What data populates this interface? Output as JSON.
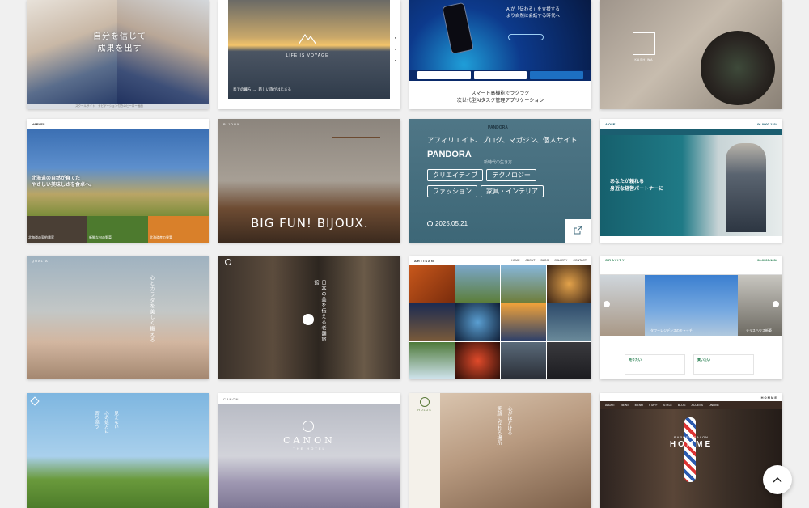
{
  "cards": [
    {
      "id": "c1",
      "headline_line1": "自分を信じて",
      "headline_line2": "成果を出す",
      "caption": "スクールサイト　ナビゲーション付きのヒーロー画面"
    },
    {
      "id": "c2",
      "logo_text": "LIFE IS VOYAGE",
      "caption": "島での暮らし、新しい旅がはじまる"
    },
    {
      "id": "c3",
      "headline_line1": "AIが「伝わる」を支援する",
      "headline_line2": "より自然に会話する時代へ",
      "sub_line1": "スマート高機能でラクラク",
      "sub_line2": "次世代型AIタスク管理アプリケーション"
    },
    {
      "id": "c4",
      "logo_text": "KASHIWA"
    },
    {
      "id": "c5",
      "brand": "HARVES",
      "headline_line1": "北海道の自然が育てた",
      "headline_line2": "やさしい美味しさを食卓へ。",
      "tile_labels": [
        "北海道の契約農家",
        "新鮮な旬の野菜",
        "北海道産の果実"
      ]
    },
    {
      "id": "c6",
      "brand": "BIJOUX",
      "headline": "BIG FUN! BIJOUX."
    },
    {
      "id": "c7",
      "brand": "PANDORA",
      "top_line": "アフィリエイト、ブログ、マガジン、個人サイト",
      "title": "PANDORA",
      "subtitle": "新時代の生き方",
      "tags": [
        "クリエイティブ",
        "テクノロジー",
        "ファッション",
        "家具・インテリア"
      ],
      "date": "2025.05.21"
    },
    {
      "id": "c8",
      "brand": "AIOSE",
      "phone": "06-0000-1234",
      "headline_line1": "あなたが頼れる",
      "headline_line2": "身近な経営パートナーに"
    },
    {
      "id": "c9",
      "brand": "QUALIA",
      "vertical_text": "心とカラダを美しく鍛える"
    },
    {
      "id": "c10",
      "vertical_text": "日本の美を伝える老舗旅館"
    },
    {
      "id": "c11",
      "brand": "ARTISAN",
      "nav": [
        "HOME",
        "ABOUT",
        "BLOG",
        "GALLERY",
        "CONTACT"
      ]
    },
    {
      "id": "c12",
      "brand": "GRAVITY",
      "phone": "06-0000-1234",
      "caption_left": "タワーレジデンスのキャッチ",
      "caption_right": "テラスハウス新築",
      "section_left": "売りたい",
      "section_right": "買いたい"
    },
    {
      "id": "c13",
      "vertical_text_1": "見えない",
      "vertical_text_2": "心の処方に",
      "vertical_text_3": "寄り添う"
    },
    {
      "id": "c14",
      "brand": "CANON",
      "logo_text": "CANON",
      "logo_sub": "THE HOTEL"
    },
    {
      "id": "c15",
      "brand": "HOLOS",
      "vertical_text_1": "心がほどける",
      "vertical_text_2": "笑顔になれる場所"
    },
    {
      "id": "c16",
      "brand": "HOMME",
      "logo_line1": "BARBER SALON",
      "logo_line2": "HOMME",
      "nav": [
        "ABOUT",
        "NEWS",
        "MENU",
        "STAFF",
        "STYLE",
        "BLOG",
        "ACCESS",
        "ONLINE"
      ]
    }
  ],
  "scroll_top_label": "^"
}
